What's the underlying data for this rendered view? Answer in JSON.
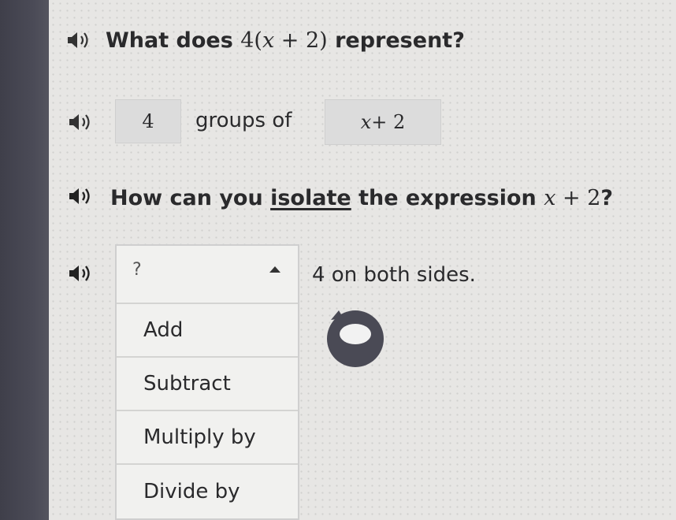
{
  "question1": {
    "prefix": "What does ",
    "coef": "4",
    "open_paren": "(",
    "var": "x",
    "op": " + ",
    "num": "2",
    "close_paren": ")",
    "suffix": " represent?"
  },
  "answer1": {
    "box1_value": "4",
    "middle_text": "groups of",
    "box2_var": "x",
    "box2_rest": " + 2"
  },
  "question2": {
    "prefix": "How can you ",
    "underlined_word": "isolate",
    "middle": " the expression ",
    "var": "x",
    "rest": " + 2",
    "suffix": "?"
  },
  "answer2": {
    "dropdown_placeholder": "?",
    "after_text": "4 on both sides.",
    "options": [
      "Add",
      "Subtract",
      "Multiply by",
      "Divide by"
    ]
  },
  "colors": {
    "background": "#e7e6e4",
    "text": "#2a2a2c",
    "box": "#dcdcdc",
    "progress_ring": "#4a4a55"
  },
  "icons": [
    "speaker-icon",
    "progress-ring-icon",
    "caret-up-icon"
  ]
}
